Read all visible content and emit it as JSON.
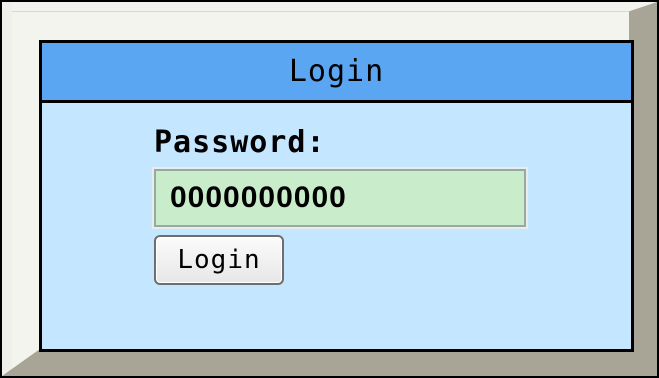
{
  "window": {
    "title": "Login"
  },
  "form": {
    "password_label": "Password:",
    "password_value": "0000000000",
    "submit_label": "Login"
  },
  "colors": {
    "title_bar": "#5ba6f2",
    "panel_background": "#c5e6ff",
    "input_background": "#c9eccb",
    "frame_shadow": "#a8a596"
  }
}
